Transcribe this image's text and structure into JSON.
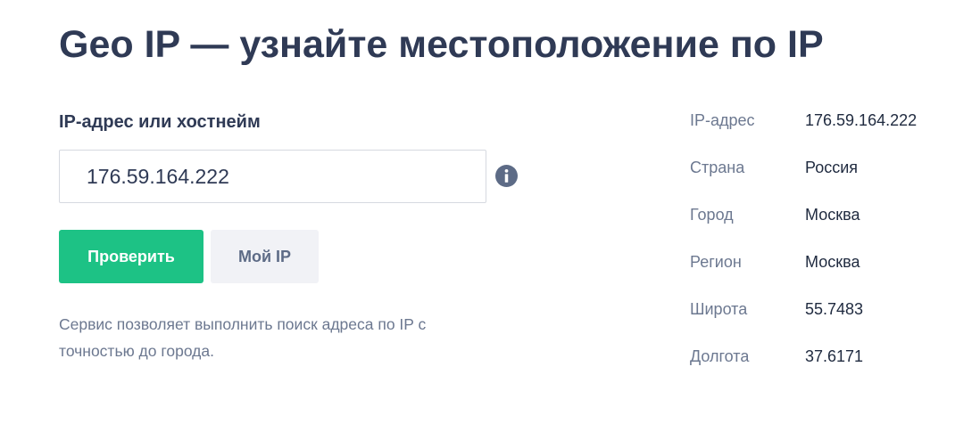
{
  "header": {
    "title": "Geo IP — узнайте местоположение по IP"
  },
  "form": {
    "label": "IP-адрес или хостнейм",
    "input_value": "176.59.164.222",
    "info_icon": "info-circle-icon",
    "check_button": "Проверить",
    "my_ip_button": "Мой IP"
  },
  "description": "Сервис позволяет выполнить поиск адреса по IP с точностью до города.",
  "result": {
    "rows": [
      {
        "key": "IP-адрес",
        "value": "176.59.164.222"
      },
      {
        "key": "Страна",
        "value": "Россия"
      },
      {
        "key": "Город",
        "value": "Москва"
      },
      {
        "key": "Регион",
        "value": "Москва"
      },
      {
        "key": "Широта",
        "value": "55.7483"
      },
      {
        "key": "Долгота",
        "value": "37.6171"
      }
    ]
  },
  "colors": {
    "title": "#2f3a55",
    "primary_button": "#1dc285",
    "secondary_button": "#f1f2f6",
    "muted_text": "#6c7890",
    "info_icon": "#5d6b86"
  }
}
